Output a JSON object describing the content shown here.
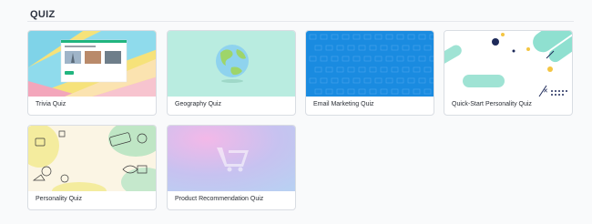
{
  "section": {
    "title": "QUIZ"
  },
  "cards": [
    {
      "label": "Trivia Quiz",
      "thumb_icon": "trivia-quiz-thumbnail"
    },
    {
      "label": "Geography Quiz",
      "thumb_icon": "globe-icon"
    },
    {
      "label": "Email Marketing Quiz",
      "thumb_icon": "blue-pattern-thumbnail"
    },
    {
      "label": "Quick-Start Personality Quiz",
      "thumb_icon": "abstract-shapes-thumbnail"
    },
    {
      "label": "Personality Quiz",
      "thumb_icon": "doodle-thumbnail"
    },
    {
      "label": "Product Recommendation Quiz",
      "thumb_icon": "shopping-cart-icon"
    }
  ],
  "colors": {
    "geography_bg": "#b9ece0",
    "email_bg": "#1a8be0",
    "cart_gradient": [
      "#f3b8e8",
      "#c7c2f0",
      "#b9d0f2"
    ]
  }
}
